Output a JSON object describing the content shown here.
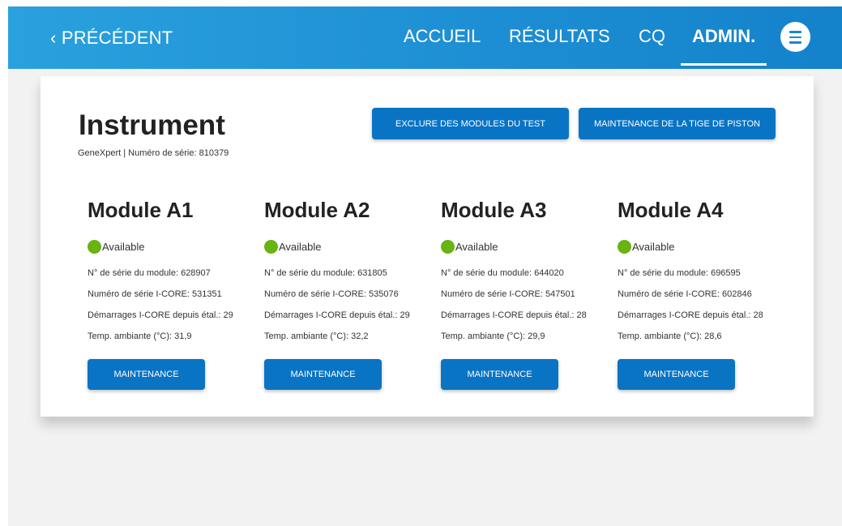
{
  "header": {
    "back_label": "‹ PRÉCÉDENT",
    "nav": [
      "ACCUEIL",
      "RÉSULTATS",
      "CQ",
      "ADMIN."
    ],
    "active_nav": "ADMIN.",
    "menu_icon": "hamburger-menu-icon"
  },
  "instrument": {
    "title": "Instrument",
    "subtitle": "GeneXpert | Numéro de série: 810379",
    "exclude_button": "EXCLURE DES MODULES DU TEST",
    "plunger_button": "MAINTENANCE DE LA TIGE DE PISTON"
  },
  "modules": [
    {
      "name": "Module A1",
      "status": "Available",
      "serial": "N° de série du module: 628907",
      "icore_serial": "Numéro de série I-CORE: 531351",
      "startups": "Démarrages I-CORE depuis étal.: 29",
      "temp": "Temp. ambiante (°C): 31,9",
      "button": "MAINTENANCE"
    },
    {
      "name": "Module A2",
      "status": "Available",
      "serial": "N° de série du module: 631805",
      "icore_serial": "Numéro de série I-CORE: 535076",
      "startups": "Démarrages I-CORE depuis étal.: 29",
      "temp": "Temp. ambiante (°C): 32,2",
      "button": "MAINTENANCE"
    },
    {
      "name": "Module A3",
      "status": "Available",
      "serial": "N° de série du module: 644020",
      "icore_serial": "Numéro de série I-CORE: 547501",
      "startups": "Démarrages I-CORE depuis étal.: 28",
      "temp": "Temp. ambiante (°C): 29,9",
      "button": "MAINTENANCE"
    },
    {
      "name": "Module A4",
      "status": "Available",
      "serial": "N° de série du module: 696595",
      "icore_serial": "Numéro de série I-CORE: 602846",
      "startups": "Démarrages I-CORE depuis étal.: 28",
      "temp": "Temp. ambiante (°C): 28,6",
      "button": "MAINTENANCE"
    }
  ],
  "colors": {
    "header_start": "#2aa1de",
    "header_end": "#1382cb",
    "button": "#0a74c4",
    "status_available": "#69b312"
  }
}
